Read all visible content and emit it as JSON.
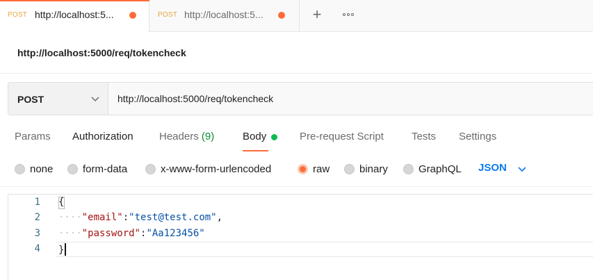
{
  "tabs": [
    {
      "method": "POST",
      "title": "http://localhost:5...",
      "unsaved": true,
      "active": true
    },
    {
      "method": "POST",
      "title": "http://localhost:5...",
      "unsaved": true,
      "active": false
    }
  ],
  "tab_actions": {
    "new_tab_icon": "plus-icon",
    "more_icon": "ellipsis-icon"
  },
  "request": {
    "title": "http://localhost:5000/req/tokencheck",
    "method": "POST",
    "url": "http://localhost:5000/req/tokencheck"
  },
  "subtabs": {
    "params": "Params",
    "authorization": "Authorization",
    "headers": "Headers",
    "headers_count": "(9)",
    "body": "Body",
    "prerequest": "Pre-request Script",
    "tests": "Tests",
    "settings": "Settings",
    "active": "Body"
  },
  "body_types": {
    "none": "none",
    "form_data": "form-data",
    "urlencoded": "x-www-form-urlencoded",
    "raw": "raw",
    "binary": "binary",
    "graphql": "GraphQL",
    "selected": "raw",
    "format": "JSON"
  },
  "editor": {
    "line_numbers": [
      "1",
      "2",
      "3",
      "4"
    ],
    "line1": "{",
    "line2": {
      "indent": "····",
      "key": "\"email\"",
      "colon": ":",
      "value": "\"test@test.com\"",
      "comma": ","
    },
    "line3": {
      "indent": "····",
      "key": "\"password\"",
      "colon": ":",
      "value": "\"Aa123456\""
    },
    "line4": "}"
  },
  "colors": {
    "accent": "#ff6c37",
    "method_tab": "#e6a53f",
    "json_blue": "#097bed",
    "status_green": "#0cbb52",
    "json_key": "#a31515",
    "json_string": "#0451a5"
  }
}
